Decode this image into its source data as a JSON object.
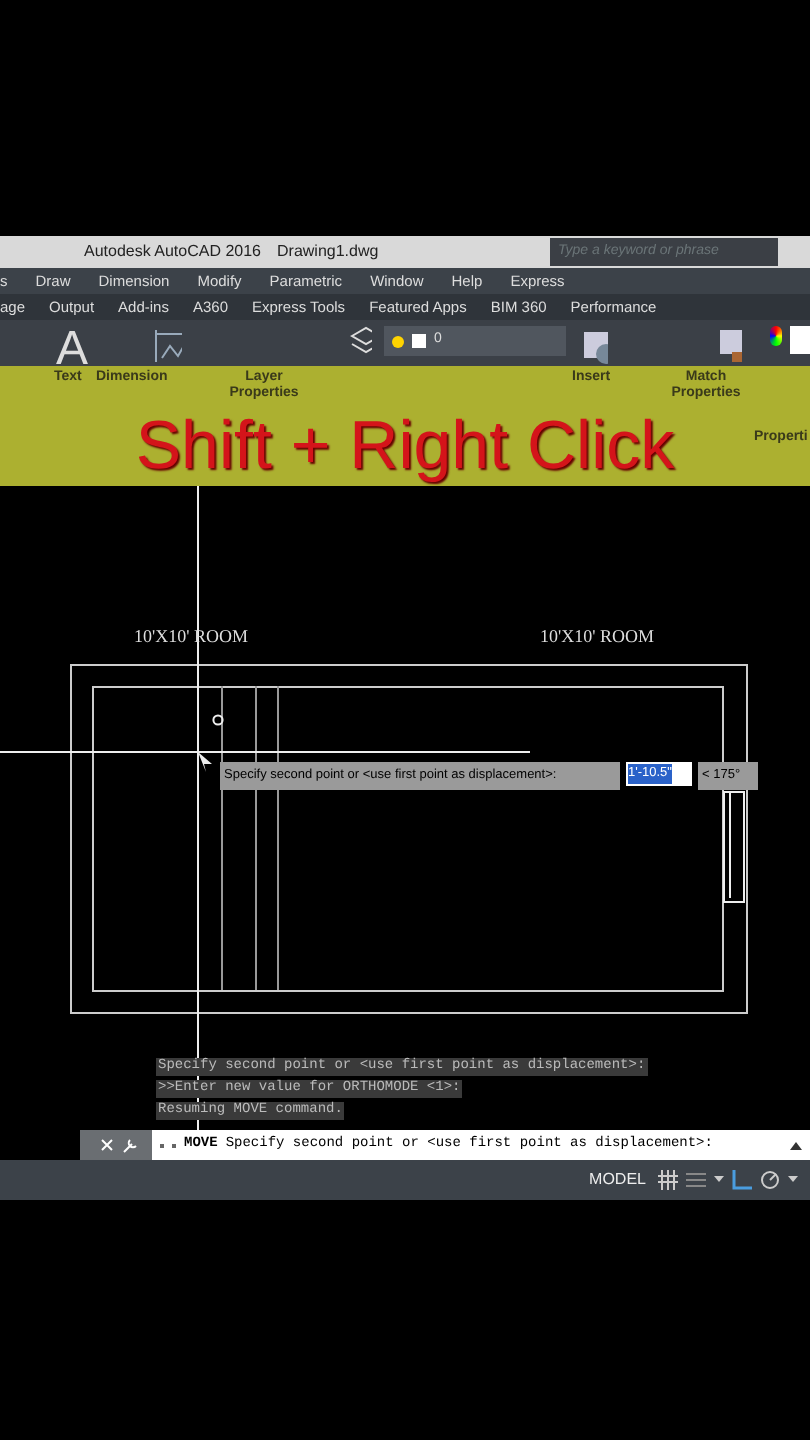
{
  "title_bar": {
    "title": "Autodesk AutoCAD 2016",
    "filename": "Drawing1.dwg",
    "search_placeholder": "Type a keyword or phrase"
  },
  "menu": [
    "s",
    "Draw",
    "Dimension",
    "Modify",
    "Parametric",
    "Window",
    "Help",
    "Express"
  ],
  "ribbon_tabs": [
    "age",
    "Output",
    "Add-ins",
    "A360",
    "Express Tools",
    "Featured Apps",
    "BIM 360",
    "Performance"
  ],
  "ribbon": {
    "text_glyph": "A",
    "layer_value": "0",
    "panels": [
      "Text",
      "Dimension",
      "Layer Properties",
      "Insert",
      "Match Properties",
      "Properti"
    ]
  },
  "banner": "Shift + Right Click",
  "drawing": {
    "labels": [
      "10'X10' ROOM",
      "10'X10' ROOM"
    ]
  },
  "tooltip": {
    "prompt": "Specify second point or <use first point as displacement>:",
    "distance": "1'-10.5\"",
    "angle": "< 175°"
  },
  "history": [
    "Specify second point or <use first point as displacement>:",
    ">>Enter new value for ORTHOMODE <1>:",
    "Resuming MOVE command."
  ],
  "command_line": {
    "command": "MOVE",
    "prompt": "Specify second point or <use first point as displacement>:"
  },
  "status_bar": {
    "space": "MODEL"
  }
}
